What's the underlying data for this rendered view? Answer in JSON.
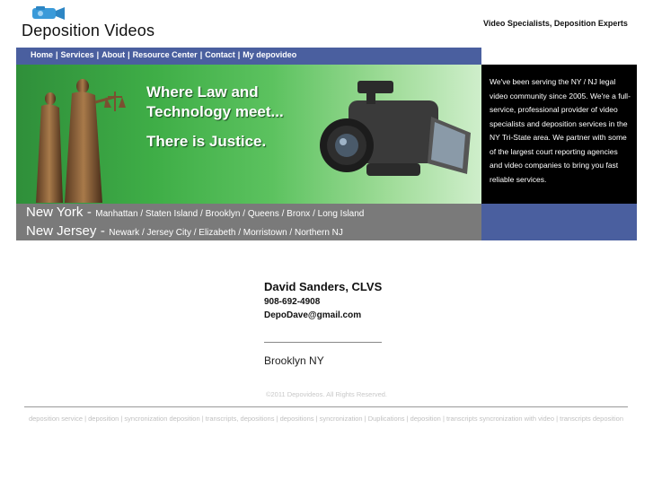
{
  "header": {
    "brand": "Deposition Videos",
    "tagline": "Video Specialists, Deposition Experts",
    "logo_icon": "video-camera-icon",
    "accent_blue": "#4a5f9f"
  },
  "nav": {
    "items": [
      {
        "label": "Home"
      },
      {
        "label": "Services"
      },
      {
        "label": "About"
      },
      {
        "label": "Resource Center"
      },
      {
        "label": "Contact"
      },
      {
        "label": "My depovideo"
      }
    ],
    "separator": "|"
  },
  "hero": {
    "line1": "Where Law and",
    "line2": "Technology meet...",
    "line3": "There is Justice.",
    "images": [
      "lady-justice-statues",
      "video-camcorder"
    ],
    "gradient_green": "#3fae47"
  },
  "about": {
    "text": "We've been serving the NY / NJ legal video community since 2005. We're a full-service, professional provider of video specialists and deposition services in the NY Tri-State area. We partner with some of the largest court reporting agencies and video companies to bring you fast reliable services."
  },
  "locations": {
    "ny_label": "New York",
    "ny_areas": "Manhattan / Staten Island / Brooklyn / Queens / Bronx / Long Island",
    "nj_label": "New Jersey",
    "nj_areas": "Newark / Jersey City / Elizabeth / Morristown / Northern NJ",
    "dash": "-"
  },
  "contact": {
    "name": "David Sanders, CLVS",
    "phone": "908-692-4908",
    "email": "DepoDave@gmail.com",
    "city": "Brooklyn NY"
  },
  "footer": {
    "copyright": "©2011 Depovideos. All Rights Reserved.",
    "links": "deposition service | deposition | syncronization deposition | transcripts, depositions | depositions | syncronization | Duplications | deposition | transcripts syncronization with video | transcripts deposition"
  }
}
